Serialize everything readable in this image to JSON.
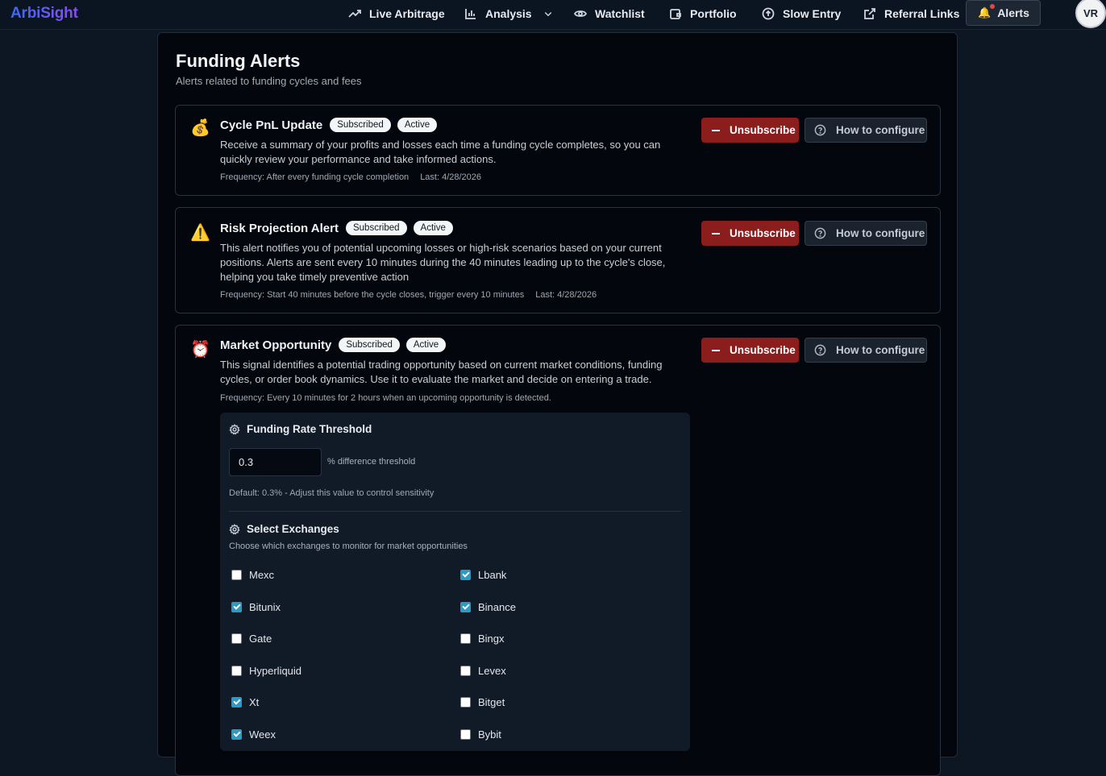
{
  "app": {
    "name": "ArbiSight"
  },
  "nav": {
    "items": [
      {
        "label": "Live Arbitrage",
        "icon": "trend-up-icon"
      },
      {
        "label": "Analysis",
        "icon": "bar-chart-icon"
      },
      {
        "label": "Watchlist",
        "icon": "eye-icon"
      },
      {
        "label": "Portfolio",
        "icon": "wallet-icon"
      },
      {
        "label": "Slow Entry",
        "icon": "arrow-up-circle-icon"
      },
      {
        "label": "Referral Links",
        "icon": "external-link-icon"
      }
    ],
    "alerts": {
      "label": "Alerts",
      "icon": "bell-icon"
    },
    "avatar": "VR"
  },
  "page": {
    "title": "Funding Alerts",
    "subtitle": "Alerts related to funding cycles and fees"
  },
  "buttons": {
    "unsubscribe": "Unsubscribe",
    "how": "How to configure"
  },
  "alerts": [
    {
      "icon": "money-bag-icon",
      "title": "Cycle PnL Update",
      "badges": [
        "Subscribed",
        "Active"
      ],
      "description": "Receive a summary of your profits and losses each time a funding cycle completes, so you can quickly review your performance and take informed actions.",
      "frequency": "Frequency: After every funding cycle completion",
      "last": "Last: 4/28/2026"
    },
    {
      "icon": "warning-icon",
      "title": "Risk Projection Alert",
      "badges": [
        "Subscribed",
        "Active"
      ],
      "description": "This alert notifies you of potential upcoming losses or high-risk scenarios based on your current positions. Alerts are sent every 10 minutes during the 40 minutes leading up to the cycle's close, helping you take timely preventive action",
      "frequency": "Frequency: Start 40 minutes before the cycle closes, trigger every 10 minutes",
      "last": "Last: 4/28/2026"
    },
    {
      "icon": "alarm-clock-icon",
      "title": "Market Opportunity",
      "badges": [
        "Subscribed",
        "Active"
      ],
      "description": "This signal identifies a potential trading opportunity based on current market conditions, funding cycles, or order book dynamics. Use it to evaluate the market and decide on entering a trade.",
      "frequency": "Frequency: Every 10 minutes for 2 hours when an upcoming opportunity is detected."
    }
  ],
  "threshold": {
    "heading": "Funding Rate Threshold",
    "value": "0.3",
    "unit": "% difference threshold",
    "default_text": "Default: 0.3% - Adjust this value to control sensitivity"
  },
  "exchanges": {
    "heading": "Select Exchanges",
    "subtitle": "Choose which exchanges to monitor for market opportunities",
    "items": [
      {
        "name": "Mexc",
        "checked": false
      },
      {
        "name": "Lbank",
        "checked": true
      },
      {
        "name": "Bitunix",
        "checked": true
      },
      {
        "name": "Binance",
        "checked": true
      },
      {
        "name": "Gate",
        "checked": false
      },
      {
        "name": "Bingx",
        "checked": false
      },
      {
        "name": "Hyperliquid",
        "checked": false
      },
      {
        "name": "Levex",
        "checked": false
      },
      {
        "name": "Xt",
        "checked": true
      },
      {
        "name": "Bitget",
        "checked": false
      },
      {
        "name": "Weex",
        "checked": true
      },
      {
        "name": "Bybit",
        "checked": false
      }
    ]
  }
}
